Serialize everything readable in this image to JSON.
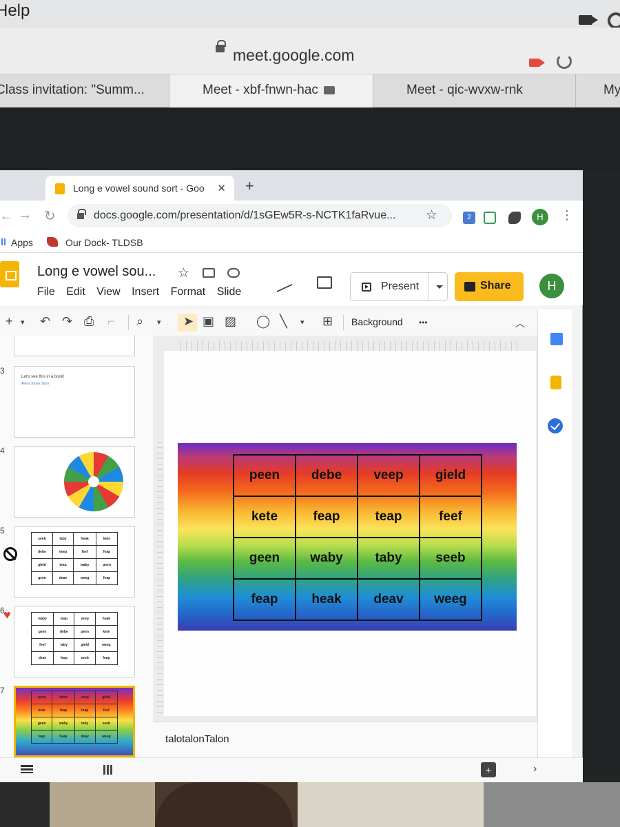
{
  "outer": {
    "menu_help": "Help",
    "url": "meet.google.com",
    "tabs": [
      {
        "label": "Class invitation: \"Summ..."
      },
      {
        "label": "Meet - xbf-fnwn-hac"
      },
      {
        "label": "Meet - qic-wvxw-rnk"
      },
      {
        "label": "My"
      }
    ]
  },
  "inner": {
    "tab_title": "Long e vowel sound sort - Goo",
    "tab_close": "✕",
    "new_tab": "+",
    "address": "docs.google.com/presentation/d/1sGEw5R-s-NCTK1faRvue...",
    "ext_badge": "2",
    "avatar_small": "H",
    "bookmarks": [
      {
        "label": "Apps"
      },
      {
        "label": "Our Dock- TLDSB"
      }
    ]
  },
  "doc": {
    "title": "Long e vowel sou...",
    "menus": [
      "File",
      "Edit",
      "View",
      "Insert",
      "Format",
      "Slide"
    ],
    "present_label": "Present",
    "share_label": "Share",
    "avatar": "H"
  },
  "toolbar": {
    "background_label": "Background",
    "more": "•••"
  },
  "filmstrip": {
    "slides": [
      {
        "num": "3",
        "text": "Let's see this in a book!",
        "sub": "Alena Stone Story"
      },
      {
        "num": "4"
      },
      {
        "num": "5",
        "rows": [
          [
            "seeb",
            "taby",
            "heak",
            "kete"
          ],
          [
            "debe",
            "veep",
            "feef",
            "feap"
          ],
          [
            "gield",
            "teap",
            "waby",
            "peen"
          ],
          [
            "geen",
            "deav",
            "weeg",
            "feap"
          ]
        ]
      },
      {
        "num": "6",
        "rows": [
          [
            "waby",
            "teap",
            "veep",
            "heak"
          ],
          [
            "geen",
            "debe",
            "peen",
            "kete"
          ],
          [
            "feef",
            "taby",
            "gield",
            "weeg"
          ],
          [
            "deav",
            "feap",
            "seeb",
            "feap"
          ]
        ]
      },
      {
        "num": "7",
        "rows": [
          [
            "peen",
            "debe",
            "veep",
            "gield"
          ],
          [
            "kete",
            "feap",
            "teap",
            "feef"
          ],
          [
            "geen",
            "waby",
            "taby",
            "seeb"
          ],
          [
            "feap",
            "heak",
            "deav",
            "weeg"
          ]
        ]
      }
    ]
  },
  "slide": {
    "rows": [
      [
        "peen",
        "debe",
        "veep",
        "gield"
      ],
      [
        "kete",
        "feap",
        "teap",
        "feef"
      ],
      [
        "geen",
        "waby",
        "taby",
        "seeb"
      ],
      [
        "feap",
        "heak",
        "deav",
        "weeg"
      ]
    ]
  },
  "notes": {
    "text": "talotalonTalon"
  }
}
